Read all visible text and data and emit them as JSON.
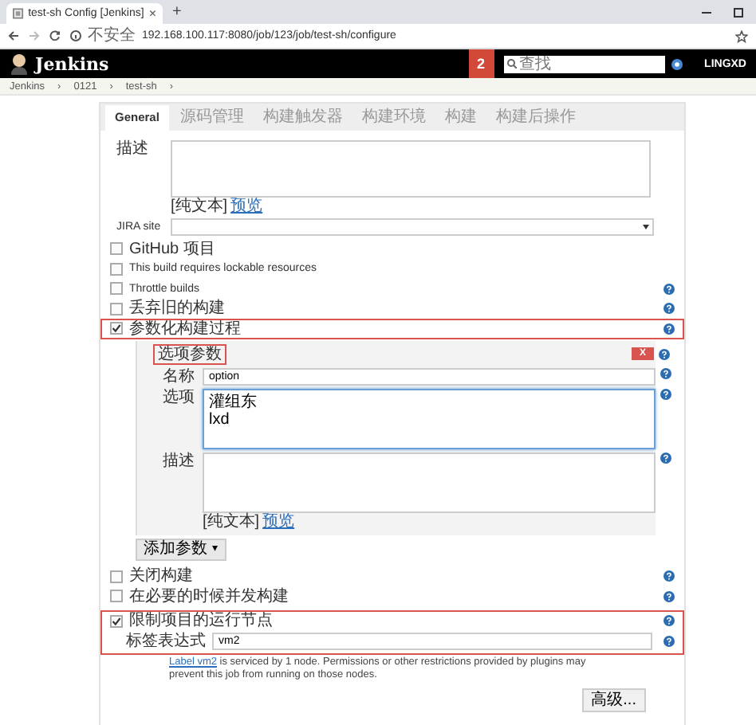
{
  "browser": {
    "tab_title": "test-sh Config [Jenkins]",
    "tab_close": "×",
    "new_tab": "+",
    "security": "不安全",
    "url": "192.168.100.117:8080/job/123/job/test-sh/configure"
  },
  "header": {
    "logo": "Jenkins",
    "badge": "2",
    "search_placeholder": "查找",
    "user": "LINGXD"
  },
  "breadcrumb": {
    "items": [
      "Jenkins",
      "0121",
      "test-sh"
    ],
    "separator": "›"
  },
  "tabs": [
    {
      "label": "General",
      "selected": true
    },
    {
      "label": "源码管理",
      "selected": false
    },
    {
      "label": "构建触发器",
      "selected": false
    },
    {
      "label": "构建环境",
      "selected": false
    },
    {
      "label": "构建",
      "selected": false
    },
    {
      "label": "构建后操作",
      "selected": false
    }
  ],
  "description": {
    "label": "描述",
    "format": "[纯文本]",
    "preview": "预览"
  },
  "jira": {
    "label": "JIRA site"
  },
  "options": [
    {
      "label": "GitHub 项目",
      "checked": false,
      "help": false,
      "highlighted": false
    },
    {
      "label": "This build requires lockable resources",
      "checked": false,
      "help": false,
      "highlighted": false
    },
    {
      "label": "Throttle builds",
      "checked": false,
      "help": true,
      "highlighted": false
    },
    {
      "label": "丢弃旧的构建",
      "checked": false,
      "help": true,
      "highlighted": false
    },
    {
      "label": "参数化构建过程",
      "checked": true,
      "help": true,
      "highlighted": true
    }
  ],
  "parameter": {
    "title": "选项参数",
    "delete": "X",
    "fields": [
      {
        "kind": "input",
        "label": "名称",
        "value": "option"
      },
      {
        "kind": "textarea",
        "label": "选项",
        "value": "灌组东\nlxd"
      },
      {
        "kind": "textarea",
        "label": "描述",
        "format": "[纯文本]",
        "preview": "预览"
      }
    ],
    "add_button": "添加参数",
    "add_caret": "▾"
  },
  "options2": [
    {
      "label": "关闭构建",
      "checked": false,
      "help": true
    },
    {
      "label": "在必要的时候并发构建",
      "checked": false,
      "help": true
    }
  ],
  "node_restriction": {
    "label": "限制项目的运行节点",
    "checked": true,
    "highlighted": true,
    "expression_label": "标签表达式",
    "expression": "vm2",
    "note_link": "Label vm2",
    "note": " is serviced by 1 node. Permissions or other restrictions provided by plugins may prevent this job from running on those nodes."
  },
  "advanced_button": "高级..."
}
